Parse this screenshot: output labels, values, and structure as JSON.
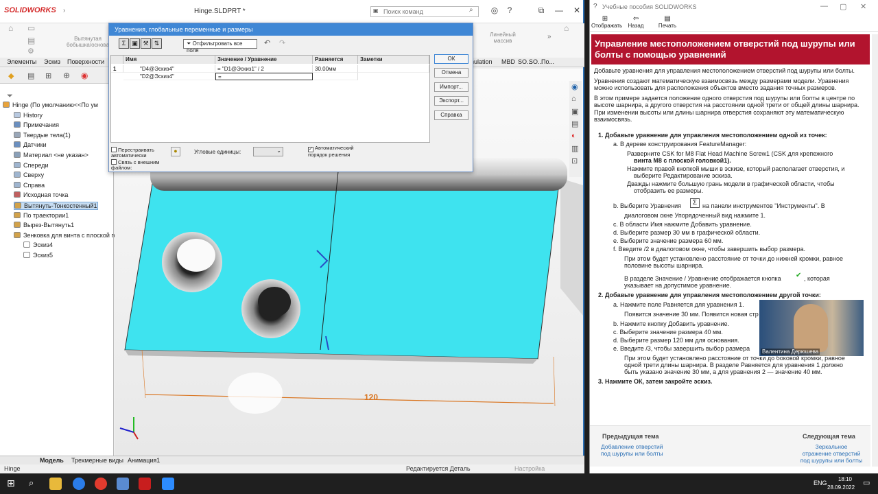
{
  "solidworks": {
    "brand": "SOLIDWORKS",
    "document_title": "Hinge.SLDPRT *",
    "search_placeholder": "Поиск команд",
    "ribbon": {
      "extrude_boss": "Вытянутая бобышка/основа",
      "linear_pattern": "Линейный массив"
    },
    "cmd_tabs": [
      "Элементы",
      "Эскиз",
      "Поверхности"
    ],
    "cmd_tabs_right": [
      "nulation",
      "MBD",
      "SO...",
      "SO...",
      "По..."
    ],
    "tree": [
      {
        "label": "Hinge  (По умолчанию<<По ум",
        "icon": "part-icon",
        "color": "#e8a33b"
      },
      {
        "label": "History",
        "icon": "history-icon",
        "color": "#b8c9e0"
      },
      {
        "label": "Примечания",
        "icon": "annotations-icon",
        "color": "#6b8fbf"
      },
      {
        "label": "Твердые тела(1)",
        "icon": "solid-bodies-icon",
        "color": "#9aa7b8"
      },
      {
        "label": "Датчики",
        "icon": "sensors-icon",
        "color": "#6b8fbf"
      },
      {
        "label": "Материал <не указан>",
        "icon": "material-icon",
        "color": "#8aa0b8"
      },
      {
        "label": "Спереди",
        "icon": "plane-icon",
        "color": "#9fb5cf"
      },
      {
        "label": "Сверху",
        "icon": "plane-icon",
        "color": "#9fb5cf"
      },
      {
        "label": "Справа",
        "icon": "plane-icon",
        "color": "#9fb5cf"
      },
      {
        "label": "Исходная точка",
        "icon": "origin-icon",
        "color": "#c06060"
      },
      {
        "label": "Вытянуть-Тонкостенный1",
        "icon": "extrude-icon",
        "color": "#d2a24a"
      },
      {
        "label": "По траектории1",
        "icon": "sweep-icon",
        "color": "#d2a24a"
      },
      {
        "label": "Вырез-Вытянуть1",
        "icon": "cut-icon",
        "color": "#d2a24a"
      },
      {
        "label": "Зенковка для  винта с плоской гол",
        "icon": "hole-icon",
        "color": "#d2a24a"
      },
      {
        "label": "Эскиз4",
        "icon": "sketch-icon",
        "color": "#ffffff"
      },
      {
        "label": "Эскиз5",
        "icon": "sketch-icon",
        "color": "#ffffff"
      }
    ],
    "bottom_tabs": [
      "Модель",
      "Трехмерные виды",
      "Анимация1"
    ],
    "status_left": "Hinge",
    "status_mid": "Редактируется Деталь",
    "status_right": "Настройка",
    "dimension_label": "120",
    "dialog": {
      "title": "Уравнения, глобальные переменные и размеры",
      "filter_btn": "Отфильтровать все поля",
      "headers": [
        "Имя",
        "Значение / Уравнение",
        "Равняется",
        "Заметки"
      ],
      "rows": [
        {
          "num": "1",
          "name": "\"D4@Эскиз4\"",
          "value": "= \"D1@Эскиз1\" / 2",
          "equals": "30.00мм",
          "notes": ""
        },
        {
          "num": "",
          "name": "\"D2@Эскиз4\"",
          "value": "=",
          "equals": "",
          "notes": ""
        }
      ],
      "buttons": [
        "ОК",
        "Отмена",
        "Импорт...",
        "Экспорт...",
        "Справка"
      ],
      "rebuild_auto": "Перестраивать автоматически",
      "link_external": "Связь с внешним файлом:",
      "angular_units": "Угловые единицы:",
      "auto_order": "Автоматический порядок решения"
    }
  },
  "help": {
    "window_title": "Учебные пособия SOLIDWORKS",
    "tools": [
      "Отображать",
      "Назад",
      "Печать"
    ],
    "heading": "Управление местоположением отверстий под шурупы или болты с помощью уравнений",
    "intro1": "Добавьте уравнения для управления местоположением отверстий под шурупы или болты.",
    "intro2": "Уравнения создают математическую взаимосвязь между размерами модели. Уравнения можно использовать для расположения объектов вместо задания точных размеров.",
    "intro3": "В этом примере задается положение одного отверстия под шурупы или болты в центре по высоте шарнира, а другого отверстия на расстоянии одной трети от общей длины шарнира. При изменении высоты или длины шарнира отверстия сохраняют эту математическую взаимосвязь.",
    "step1": "1.  Добавьте уравнение для управления местоположением одной из точек:",
    "s1a": "a.  В дереве конструирования FeatureManager:",
    "s1a_b1": "Разверните CSK for M8 Flat Head Machine Screw1 (CSK для крепежного",
    "s1a_b1b": "винта М8 с плоской головкой1).",
    "s1a_b2": "Нажмите правой кнопкой мыши в эскизе, который располагает отверстия, и",
    "s1a_b2b": "выберите Редактирование эскиза.",
    "s1a_b3": "Дважды нажмите большую грань модели в графической области, чтобы",
    "s1a_b3b": "отобразить ее размеры.",
    "s1b": "b.  Выберите Уравнения",
    "s1b_tail": "на панели инструментов \"Инструменты\". В",
    "s1b2": "диалоговом окне Упорядоченный вид нажмите 1.",
    "s1c": "c.  В области Имя нажмите Добавить уравнение.",
    "s1d": "d.  Выберите размер 30 мм в графической области.",
    "s1e": "e.  Выберите значение размера 60 мм.",
    "s1f": "f.  Введите /2 в диалоговом окне, чтобы завершить выбор размера.",
    "s1f_n1": "При этом будет установлено расстояние от точки до нижней кромки, равное",
    "s1f_n2": "половине высоты шарнира.",
    "s1f_n3": "В разделе Значение / Уравнение отображается кнопка",
    "s1f_n3b": ", которая",
    "s1f_n4": "указывает на допустимое уравнение.",
    "step2": "2.  Добавьте уравнение для управления местоположением другой точки:",
    "s2a": "a.  Нажмите поле Равняется для уравнения 1.",
    "s2a_n": "Появится значение 30 мм. Появится новая стр",
    "s2b": "b.  Нажмите кнопку Добавить уравнение.",
    "s2c": "c.  Выберите значение размера 40 мм.",
    "s2d": "d.  Выберите размер 120 мм для основания.",
    "s2e": "e.  Введите /3, чтобы завершить выбор размера",
    "s2e_n1": "При этом будет установлено расстояние от точки до боковой кромки, равное",
    "s2e_n2": "одной трети длины шарнира. В разделе Равняется для уравнения 1 должно",
    "s2e_n3": "быть указано значение 30 мм, а для уравнения 2 — значение 40 мм.",
    "step3": "3.  Нажмите ОК, затем закройте эскиз.",
    "prev_label": "Предыдущая тема",
    "prev_link1": "Добавление отверстий",
    "prev_link2": "под шурупы или болты",
    "next_label": "Следующая тема",
    "next_link1": "Зеркальное",
    "next_link2": "отражение отверстий",
    "next_link3": "под шурупы или болты",
    "presenter": "Валентина Дерюшева"
  },
  "taskbar": {
    "lang": "ENG",
    "time": "18:10",
    "date": "28.09.2022"
  },
  "colors": {
    "part_face": "#3ee3ef",
    "dimension": "#d9741f",
    "help_heading": "#b2142e",
    "accent": "#2a6fb5"
  }
}
